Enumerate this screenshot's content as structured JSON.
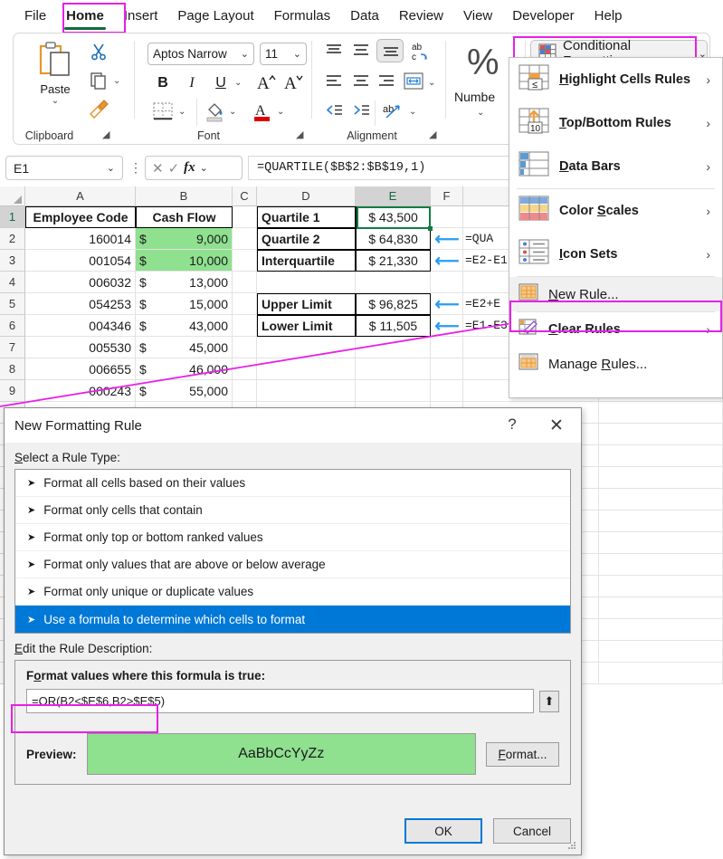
{
  "ribbon": {
    "tabs": [
      {
        "label": "File",
        "active": false
      },
      {
        "label": "Home",
        "active": true
      },
      {
        "label": "Insert",
        "active": false
      },
      {
        "label": "Page Layout",
        "active": false
      },
      {
        "label": "Formulas",
        "active": false
      },
      {
        "label": "Data",
        "active": false
      },
      {
        "label": "Review",
        "active": false
      },
      {
        "label": "View",
        "active": false
      },
      {
        "label": "Developer",
        "active": false
      },
      {
        "label": "Help",
        "active": false
      }
    ],
    "groups": {
      "clipboard": {
        "label": "Clipboard",
        "paste_label": "Paste"
      },
      "font": {
        "label": "Font",
        "font_name": "Aptos Narrow",
        "font_size": "11",
        "bold": "B",
        "italic": "I",
        "underline": "U"
      },
      "alignment": {
        "label": "Alignment"
      },
      "number": {
        "label": "Numbe",
        "percent": "%"
      }
    },
    "conditional_formatting_button": "Conditional Formatting",
    "highlight_color": "#e81fe8"
  },
  "cf_menu": {
    "items": [
      {
        "label": "Highlight Cells Rules",
        "accel": "H",
        "submenu": true,
        "icon": "highlight-cells-icon",
        "selected": false
      },
      {
        "label": "Top/Bottom Rules",
        "accel": "T",
        "submenu": true,
        "icon": "top-bottom-icon",
        "selected": false
      },
      {
        "label": "Data Bars",
        "accel": "D",
        "submenu": true,
        "icon": "data-bars-icon",
        "selected": false
      },
      {
        "label": "Color Scales",
        "accel": "S",
        "submenu": true,
        "icon": "color-scales-icon",
        "selected": false
      },
      {
        "label": "Icon Sets",
        "accel": "I",
        "submenu": true,
        "icon": "icon-sets-icon",
        "selected": false
      },
      {
        "label": "New Rule...",
        "accel": "N",
        "submenu": false,
        "icon": "new-rule-icon",
        "selected": true
      },
      {
        "label": "Clear Rules",
        "accel": "C",
        "submenu": true,
        "icon": "clear-rules-icon",
        "selected": false
      },
      {
        "label": "Manage Rules...",
        "accel": "R",
        "submenu": false,
        "icon": "manage-rules-icon",
        "selected": false
      }
    ]
  },
  "formula_bar": {
    "name_box": "E1",
    "formula": "=QUARTILE($B$2:$B$19,1)",
    "cancel_icon": "cancel-icon",
    "enter_icon": "enter-icon",
    "fx_icon": "fx-icon"
  },
  "sheet": {
    "column_headers": [
      "A",
      "B",
      "C",
      "D",
      "E",
      "F"
    ],
    "selected_column": "E",
    "row_headers": [
      "1",
      "2",
      "3",
      "4",
      "5",
      "6",
      "7",
      "8",
      "9"
    ],
    "selected_row": "1",
    "columns_A_B": {
      "header_a": "Employee Code",
      "header_b": "Cash Flow",
      "rows": [
        {
          "code": "160014",
          "cur": "$",
          "amount": "9,000",
          "highlight": true
        },
        {
          "code": "001054",
          "cur": "$",
          "amount": "10,000",
          "highlight": true
        },
        {
          "code": "006032",
          "cur": "$",
          "amount": "13,000",
          "highlight": false
        },
        {
          "code": "054253",
          "cur": "$",
          "amount": "15,000",
          "highlight": false
        },
        {
          "code": "004346",
          "cur": "$",
          "amount": "43,000",
          "highlight": false
        },
        {
          "code": "005530",
          "cur": "$",
          "amount": "45,000",
          "highlight": false
        },
        {
          "code": "006655",
          "cur": "$",
          "amount": "46,000",
          "highlight": false
        },
        {
          "code": "000243",
          "cur": "$",
          "amount": "55,000",
          "highlight": false
        }
      ]
    },
    "stats": [
      {
        "row": 1,
        "label": "Quartile 1",
        "value": "$ 43,500",
        "note": "=QUA",
        "has_arrow": false
      },
      {
        "row": 2,
        "label": "Quartile 2",
        "value": "$ 64,830",
        "note": "=QUA",
        "has_arrow": true
      },
      {
        "row": 3,
        "label": "Interquartile",
        "value": "$ 21,330",
        "note": "=E2-E1",
        "has_arrow": true
      },
      {
        "row": 5,
        "label": "Upper Limit",
        "value": "$ 96,825",
        "note": "=E2+E",
        "has_arrow": true
      },
      {
        "row": 6,
        "label": "Lower Limit",
        "value": "$ 11,505",
        "note": "=E1-E3",
        "has_arrow": true
      }
    ],
    "highlight_fill": "#8fe08f"
  },
  "dialog": {
    "title": "New Formatting Rule",
    "help_icon": "question-mark-icon",
    "close_icon": "close-icon",
    "rule_type_label": "Select a Rule Type:",
    "rule_types": [
      {
        "label": "Format all cells based on their values",
        "selected": false
      },
      {
        "label": "Format only cells that contain",
        "selected": false
      },
      {
        "label": "Format only top or bottom ranked values",
        "selected": false
      },
      {
        "label": "Format only values that are above or below average",
        "selected": false
      },
      {
        "label": "Format only unique or duplicate values",
        "selected": false
      },
      {
        "label": "Use a formula to determine which cells to format",
        "selected": true
      }
    ],
    "edit_desc_label": "Edit the Rule Description:",
    "formula_label": "Format values where this formula is true:",
    "formula_value": "=OR(B2<$E$6,B2>$E$5)",
    "collapse_icon": "range-selector-icon",
    "preview_label": "Preview:",
    "preview_sample": "AaBbCcYyZz",
    "preview_fill": "#8fe08f",
    "format_button": "Format...",
    "ok_button": "OK",
    "cancel_button": "Cancel"
  }
}
